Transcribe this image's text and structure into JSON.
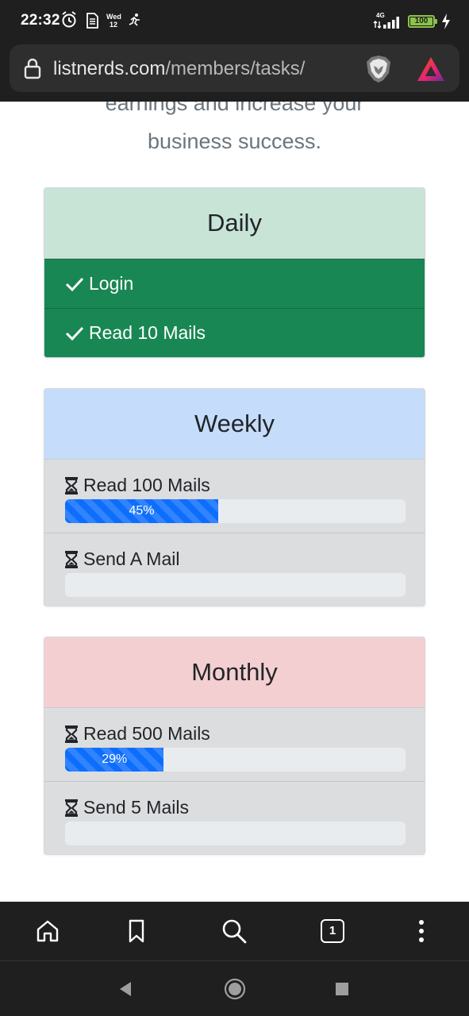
{
  "status_bar": {
    "time": "22:32",
    "day_name": "Wed",
    "day_number": "12",
    "network": "4G",
    "battery": "100",
    "icons": [
      "alarm-icon",
      "sim-icon",
      "calendar-day",
      "activity-icon",
      "signal-icon",
      "battery-icon",
      "charging-icon"
    ]
  },
  "browser": {
    "url_domain": "listnerds.com",
    "url_path": "/members/tasks/",
    "icons": [
      "lock-icon",
      "brave-shields-icon",
      "brave-rewards-icon"
    ]
  },
  "page": {
    "intro_fragment": "earnings and increase your",
    "intro_line": "business success."
  },
  "daily": {
    "title": "Daily",
    "items": [
      {
        "label": "Login",
        "status": "completed"
      },
      {
        "label": "Read 10 Mails",
        "status": "completed"
      }
    ]
  },
  "weekly": {
    "title": "Weekly",
    "tasks": [
      {
        "label": "Read 100 Mails",
        "progress_percent": 45,
        "progress_label": "45%"
      },
      {
        "label": "Send A Mail",
        "progress_percent": 0,
        "progress_label": ""
      }
    ]
  },
  "monthly": {
    "title": "Monthly",
    "tasks": [
      {
        "label": "Read 500 Mails",
        "progress_percent": 29,
        "progress_label": "29%"
      },
      {
        "label": "Send 5 Mails",
        "progress_percent": 0,
        "progress_label": ""
      }
    ]
  },
  "toolbar": {
    "tab_count": "1",
    "icons": [
      "home-icon",
      "bookmark-icon",
      "search-icon",
      "tabs-icon",
      "menu-icon"
    ]
  },
  "nav": {
    "icons": [
      "back-icon",
      "home-icon",
      "recents-icon"
    ]
  },
  "colors": {
    "daily_header": "#c8e4d7",
    "daily_item": "#198754",
    "weekly_header": "#c5dcfb",
    "monthly_header": "#f4cfd1",
    "progress_bar": "#0d6efd",
    "progress_track": "#e9ecef"
  }
}
